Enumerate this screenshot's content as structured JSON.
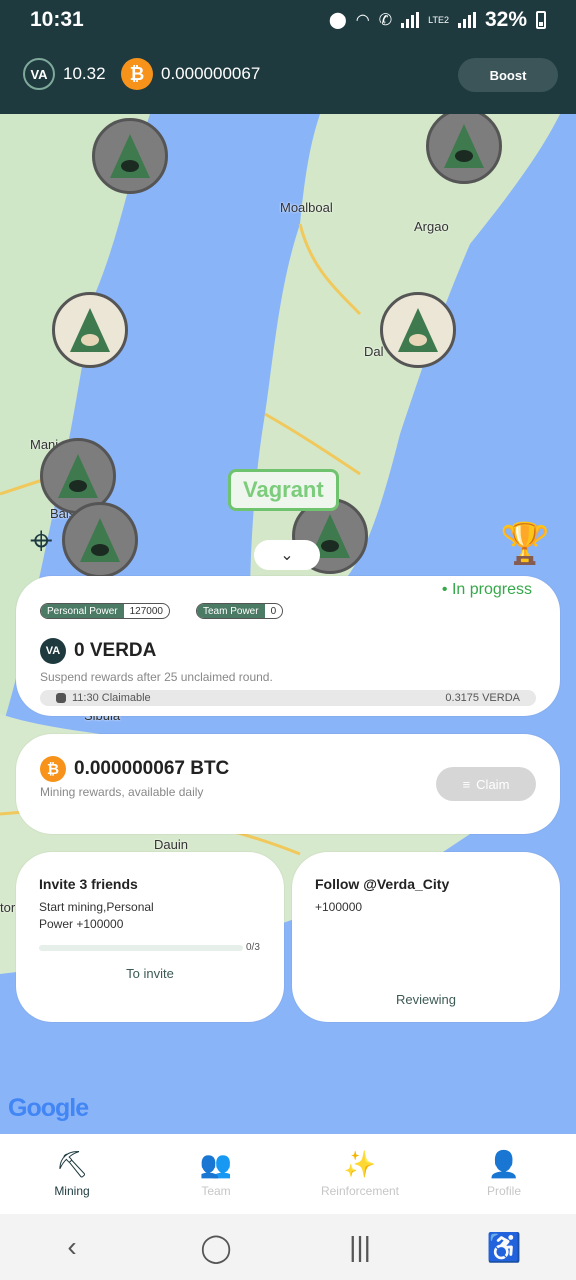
{
  "status_bar": {
    "time": "10:31",
    "battery": "32%",
    "network": "LTE2"
  },
  "header": {
    "va_label": "VA",
    "va_balance": "10.32",
    "btc_symbol": "₿",
    "btc_balance": "0.000000067",
    "boost_label": "Boost"
  },
  "map": {
    "places": [
      "Moalboal",
      "Argao",
      "Dal",
      "Mani",
      "Bais",
      "Sibula",
      "Dauin",
      "tor"
    ],
    "highlight_label": "Vagrant",
    "google_label": "Google"
  },
  "mining_card": {
    "status": "In progress",
    "personal_power_label": "Personal Power",
    "personal_power_value": "127000",
    "team_power_label": "Team Power",
    "team_power_value": "0",
    "verda_amount": "0 VERDA",
    "suspend_note": "Suspend rewards after 25 unclaimed round.",
    "claimable_time": "11:30 Claimable",
    "claimable_amount": "0.3175 VERDA"
  },
  "btc_card": {
    "amount": "0.000000067 BTC",
    "note": "Mining rewards, available daily",
    "claim_label": "Claim"
  },
  "tasks": [
    {
      "title": "Invite 3 friends",
      "desc": "Start mining,Personal Power +100000",
      "progress": "0/3",
      "progress_fraction": 0,
      "action": "To invite"
    },
    {
      "title": "Follow @Verda_City",
      "desc": "+100000",
      "action": "Reviewing"
    }
  ],
  "bottom_nav": [
    {
      "label": "Mining",
      "icon": "shovel-icon",
      "active": true
    },
    {
      "label": "Team",
      "icon": "team-icon",
      "active": false
    },
    {
      "label": "Reinforcement",
      "icon": "magic-wand-icon",
      "active": false
    },
    {
      "label": "Profile",
      "icon": "profile-icon",
      "active": false
    }
  ],
  "colors": {
    "brand_dark": "#1e3a3f",
    "accent_green": "#35a84a",
    "btc_orange": "#f7931a"
  }
}
